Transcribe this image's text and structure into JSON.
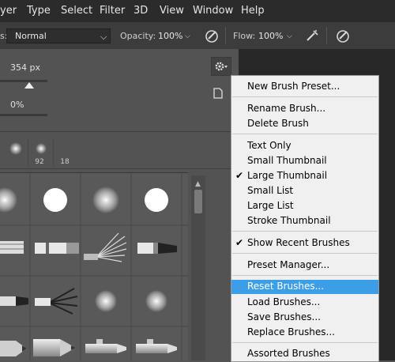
{
  "menubar": {
    "items": [
      "yer",
      "Type",
      "Select",
      "Filter",
      "3D",
      "View",
      "Window",
      "Help"
    ]
  },
  "options": {
    "mode_value": "Normal",
    "opacity_label": "Opacity:",
    "opacity_value": "100%",
    "flow_label": "Flow:",
    "flow_value": "100%"
  },
  "brush_panel": {
    "size_value": "354 px",
    "hardness_value": "0%",
    "recent_sizes": [
      "92",
      "18"
    ]
  },
  "menu": {
    "new_brush_preset": "New Brush Preset...",
    "rename_brush": "Rename Brush...",
    "delete_brush": "Delete Brush",
    "text_only": "Text Only",
    "small_thumbnail": "Small Thumbnail",
    "large_thumbnail": "Large Thumbnail",
    "small_list": "Small List",
    "large_list": "Large List",
    "stroke_thumbnail": "Stroke Thumbnail",
    "show_recent_brushes": "Show Recent Brushes",
    "preset_manager": "Preset Manager...",
    "reset_brushes": "Reset Brushes...",
    "load_brushes": "Load Brushes...",
    "save_brushes": "Save Brushes...",
    "replace_brushes": "Replace Brushes...",
    "assorted_brushes": "Assorted Brushes",
    "check_mark": "✔"
  },
  "colors": {
    "menu_highlight": "#3d9ee8",
    "panel_bg": "#535353",
    "menubar_bg": "#2b2b2b"
  }
}
